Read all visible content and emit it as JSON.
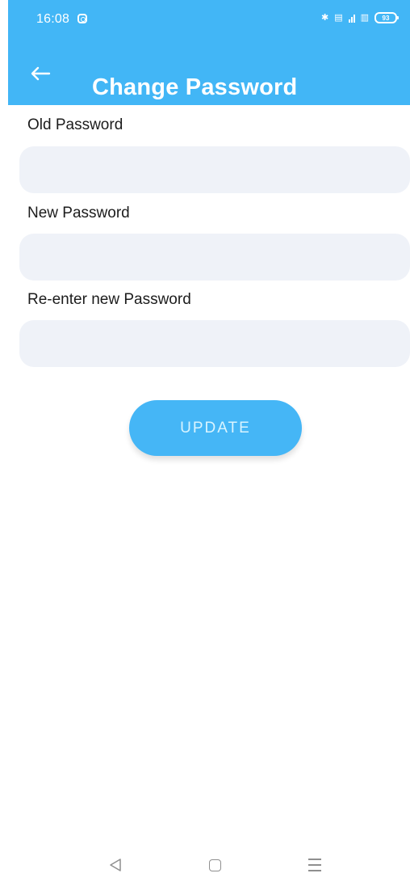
{
  "status_bar": {
    "time": "16:08",
    "battery": "93",
    "icons": [
      "camera-icon",
      "bluetooth-icon",
      "vibrate-icon",
      "signal-icon",
      "network-icon",
      "battery-icon"
    ]
  },
  "app_bar": {
    "title": "Change Password",
    "back_icon": "back-arrow-icon",
    "background": "#42B6F6"
  },
  "form": {
    "fields": [
      {
        "label": "Old Password",
        "value": "",
        "placeholder": ""
      },
      {
        "label": "New Password",
        "value": "",
        "placeholder": ""
      },
      {
        "label": "Re-enter new Password",
        "value": "",
        "placeholder": ""
      }
    ],
    "update_button": {
      "label": "UPDATE",
      "color": "#45B6F6"
    },
    "field_background": "#EFF2F8"
  },
  "navigation": {
    "icons": [
      "back-icon",
      "home-icon",
      "menu-icon"
    ]
  }
}
